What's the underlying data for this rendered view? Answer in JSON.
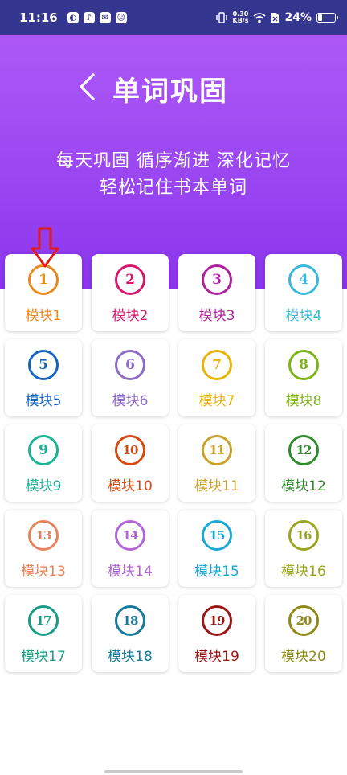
{
  "status_bar": {
    "time": "11:16",
    "net_speed_value": "0.30",
    "net_speed_unit": "KB/s",
    "battery": "24%",
    "battery_level": 0.24
  },
  "header": {
    "title": "单词巩固",
    "subtitle_line1": "每天巩固  循序渐进  深化记忆",
    "subtitle_line2": "轻松记住书本单词"
  },
  "modules": [
    {
      "num": "1",
      "label": "模块1",
      "color": "#e8871c"
    },
    {
      "num": "2",
      "label": "模块2",
      "color": "#d6176d"
    },
    {
      "num": "3",
      "label": "模块3",
      "color": "#b0209e"
    },
    {
      "num": "4",
      "label": "模块4",
      "color": "#3ab8d9"
    },
    {
      "num": "5",
      "label": "模块5",
      "color": "#1565c0"
    },
    {
      "num": "6",
      "label": "模块6",
      "color": "#8e6bc9"
    },
    {
      "num": "7",
      "label": "模块7",
      "color": "#eab308"
    },
    {
      "num": "8",
      "label": "模块8",
      "color": "#7cb518"
    },
    {
      "num": "9",
      "label": "模块9",
      "color": "#19b494"
    },
    {
      "num": "10",
      "label": "模块10",
      "color": "#d9480f"
    },
    {
      "num": "11",
      "label": "模块11",
      "color": "#c9a227"
    },
    {
      "num": "12",
      "label": "模块12",
      "color": "#2e8b2e"
    },
    {
      "num": "13",
      "label": "模块13",
      "color": "#e8825a"
    },
    {
      "num": "14",
      "label": "模块14",
      "color": "#b265d6"
    },
    {
      "num": "15",
      "label": "模块15",
      "color": "#1aa9d6"
    },
    {
      "num": "16",
      "label": "模块16",
      "color": "#9aa61f"
    },
    {
      "num": "17",
      "label": "模块17",
      "color": "#189c84"
    },
    {
      "num": "18",
      "label": "模块18",
      "color": "#167a9c"
    },
    {
      "num": "19",
      "label": "模块19",
      "color": "#9c1414"
    },
    {
      "num": "20",
      "label": "模块20",
      "color": "#8f8a18"
    }
  ],
  "annotation": {
    "arrow_color": "#e01b1b",
    "target": "模块1"
  }
}
